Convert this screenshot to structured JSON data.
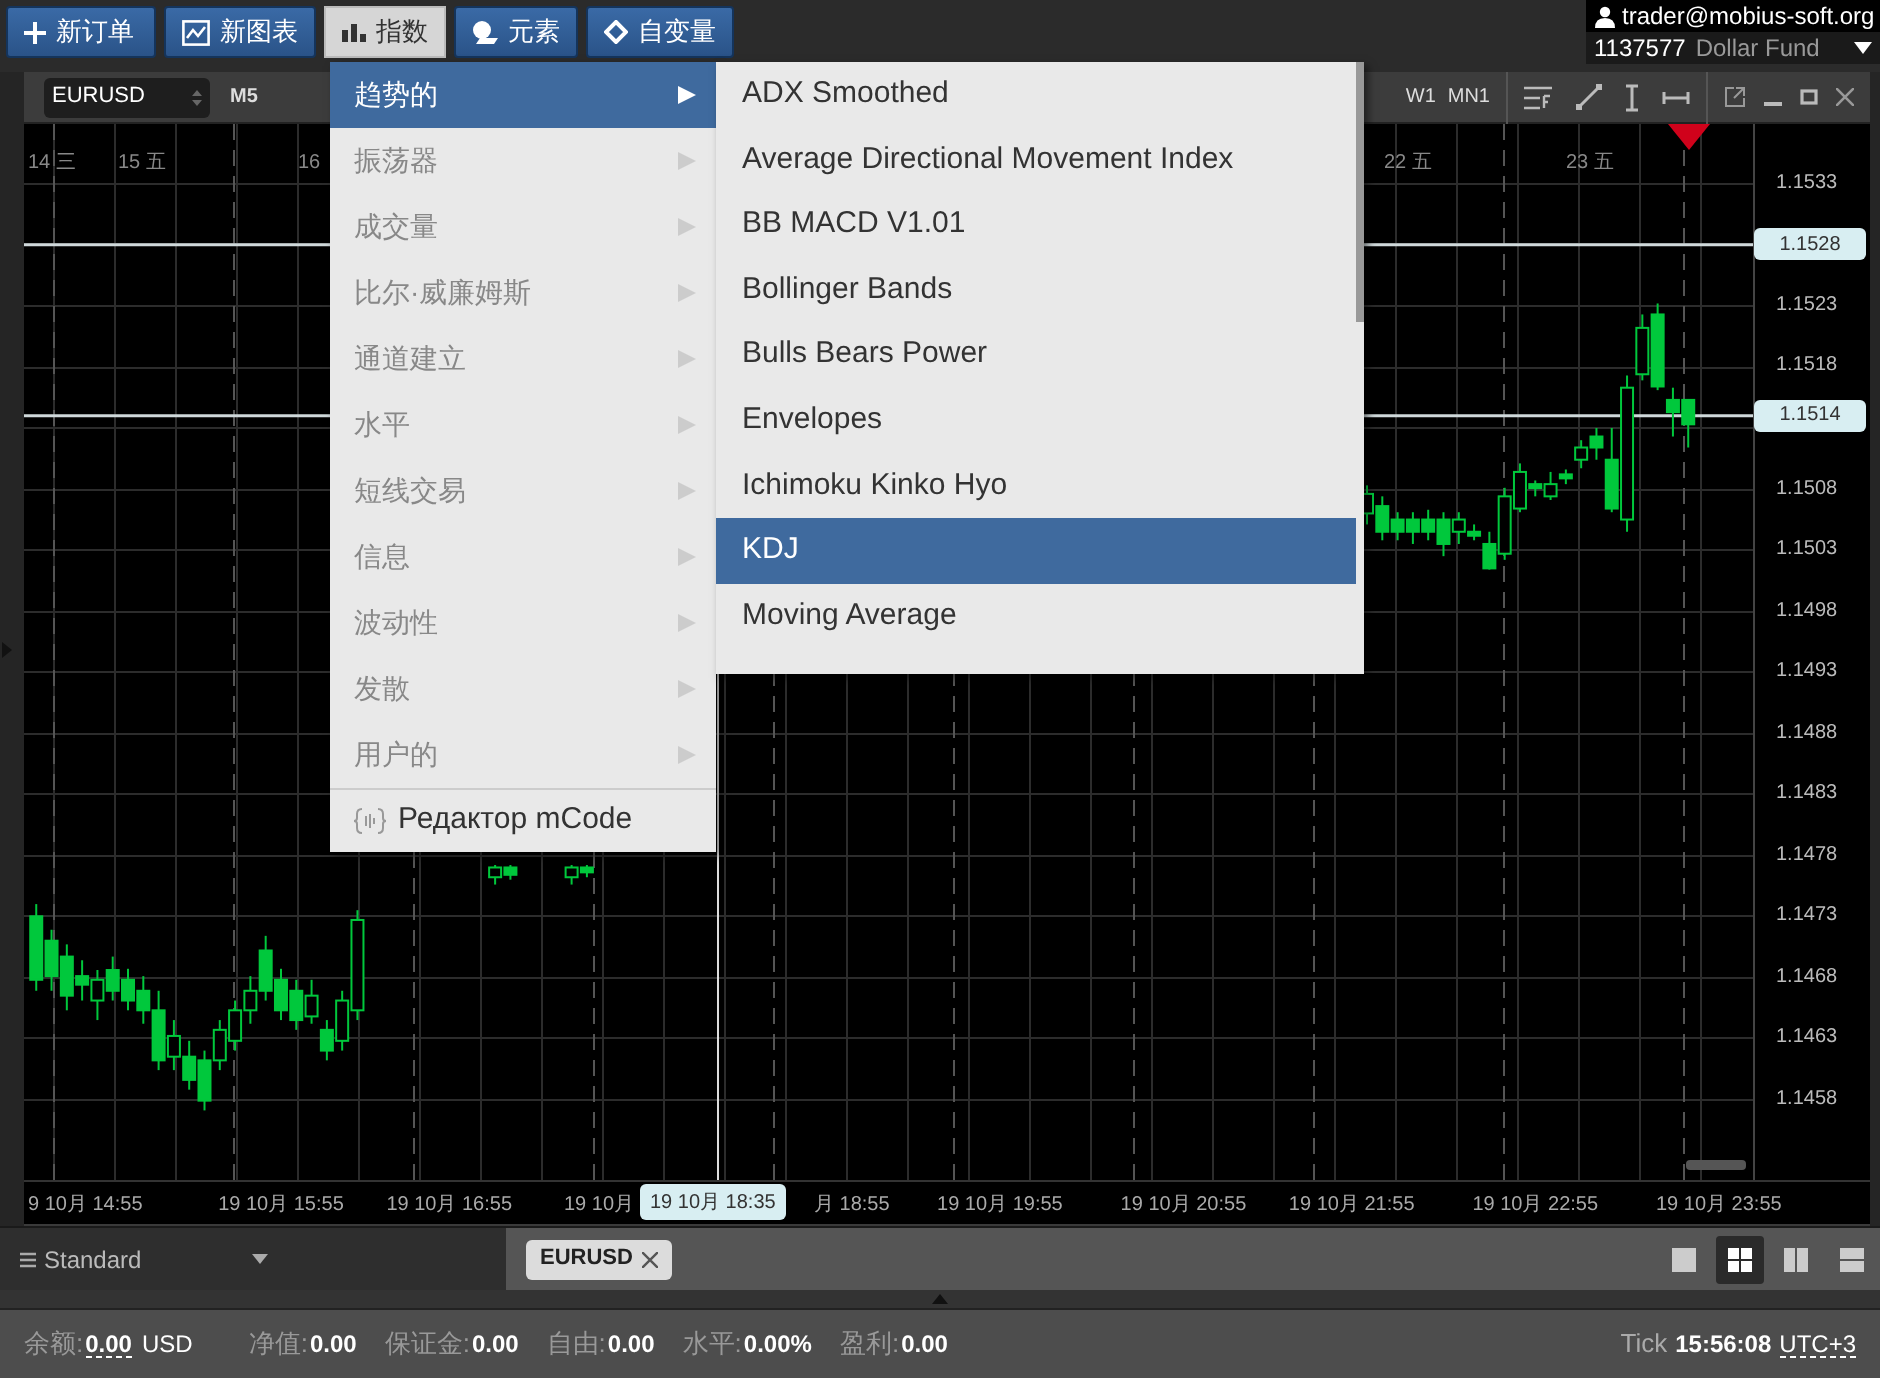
{
  "toolbar": {
    "buttons": [
      {
        "kind": "plus",
        "label": "新订单",
        "selected": false
      },
      {
        "kind": "chart",
        "label": "新图表",
        "selected": false
      },
      {
        "kind": "bars",
        "label": "指数",
        "selected": true
      },
      {
        "kind": "shapes",
        "label": "元素",
        "selected": false
      },
      {
        "kind": "diamond",
        "label": "自变量",
        "selected": false
      }
    ]
  },
  "account": {
    "user": "trader@mobius-soft.org",
    "number": "1137577",
    "fund": "Dollar Fund"
  },
  "chart_window": {
    "symbol": "EURUSD",
    "timeframe": "M5",
    "periods": [
      "W1",
      "MN1"
    ]
  },
  "chart": {
    "day_labels": [
      "14 三",
      "15 五",
      "16",
      "22 五",
      "23 五"
    ],
    "chart_data": {
      "type": "candlestick",
      "grid": true,
      "ylim": [
        1.14514,
        1.15379
      ],
      "ref_lines": [
        {
          "axis": "y",
          "value": 1.1528,
          "label": "1.1528"
        },
        {
          "axis": "y",
          "value": 1.1514,
          "label": "1.1514"
        }
      ],
      "categories": [
        null,
        null,
        null,
        null,
        null,
        null,
        null,
        null,
        null,
        null,
        null,
        null,
        null,
        null,
        null,
        null,
        "19 10月 15:55",
        null,
        null,
        null,
        null,
        null,
        null,
        null,
        null,
        null,
        null,
        "19 10月 16:55",
        null,
        null,
        null,
        null,
        null,
        null,
        null,
        null,
        null,
        null,
        null,
        null,
        null,
        null,
        null,
        null,
        null,
        null,
        null,
        null,
        null,
        null,
        null,
        null,
        null,
        null,
        null,
        null,
        null,
        null,
        null,
        null,
        null,
        null,
        null,
        "19 10月 19:55",
        null,
        null,
        null,
        null,
        null,
        null,
        null,
        null,
        null,
        null,
        null,
        "19 10月 20:55",
        null,
        null,
        null,
        null,
        null,
        null,
        null,
        null,
        null,
        null,
        "19 10月 21:55",
        null,
        null,
        null,
        null,
        null,
        null,
        null,
        null,
        null,
        null,
        null,
        "19 10月 22:55",
        null,
        null,
        null,
        null,
        null,
        null,
        null,
        null,
        null,
        null,
        null,
        "19 10月 23:55"
      ],
      "yticks": [
        {
          "value": 1.1533,
          "label": "1.1533"
        },
        {
          "value": 1.1523,
          "label": "1.1523"
        },
        {
          "value": 1.1518,
          "label": "1.1518"
        },
        {
          "value": 1.1508,
          "label": "1.1508"
        },
        {
          "value": 1.1503,
          "label": "1.1503"
        },
        {
          "value": 1.1498,
          "label": "1.1498"
        },
        {
          "value": 1.1493,
          "label": "1.1493"
        },
        {
          "value": 1.1488,
          "label": "1.1488"
        },
        {
          "value": 1.1483,
          "label": "1.1483"
        },
        {
          "value": 1.1478,
          "label": "1.1478"
        },
        {
          "value": 1.1473,
          "label": "1.1473"
        },
        {
          "value": 1.1468,
          "label": "1.1468"
        },
        {
          "value": 1.1463,
          "label": "1.1463"
        },
        {
          "value": 1.1458,
          "label": "1.1458"
        }
      ],
      "ohlc": [
        [
          1.1473,
          1.1474,
          1.14669,
          1.14678
        ],
        [
          1.1471,
          1.14719,
          1.14669,
          1.14681
        ],
        [
          1.14697,
          1.14707,
          1.14653,
          1.14665
        ],
        [
          1.14681,
          1.14694,
          1.14661,
          1.14674
        ],
        [
          1.14661,
          1.14686,
          1.14645,
          1.14678
        ],
        [
          1.14686,
          1.14697,
          1.14661,
          1.14669
        ],
        [
          1.14678,
          1.14687,
          1.14653,
          1.14661
        ],
        [
          1.14669,
          1.14681,
          1.14642,
          1.14653
        ],
        [
          1.14653,
          1.14669,
          1.14604,
          1.14612
        ],
        [
          1.14615,
          1.14645,
          1.14604,
          1.14632
        ],
        [
          1.14615,
          1.14628,
          1.14588,
          1.14596
        ],
        [
          1.14612,
          1.1462,
          1.14571,
          1.14579
        ],
        [
          1.14612,
          1.14645,
          1.14604,
          1.14637
        ],
        [
          1.14628,
          1.14661,
          1.1462,
          1.14653
        ],
        [
          1.14653,
          1.14681,
          1.14642,
          1.14669
        ],
        [
          1.14702,
          1.14714,
          1.14661,
          1.14669
        ],
        [
          1.14678,
          1.14687,
          1.14645,
          1.14653
        ],
        [
          1.14669,
          1.14678,
          1.14637,
          1.14645
        ],
        [
          1.14648,
          1.14678,
          1.14642,
          1.14665
        ],
        [
          1.14637,
          1.14645,
          1.14612,
          1.1462
        ],
        [
          1.14628,
          1.14669,
          1.1462,
          1.14661
        ],
        [
          1.14653,
          1.14735,
          1.14645,
          1.14727
        ],
        null,
        null,
        null,
        null,
        null,
        null,
        null,
        null,
        [
          1.14762,
          1.14772,
          1.14756,
          1.1477
        ],
        [
          1.1477,
          1.14772,
          1.1476,
          1.14764
        ],
        null,
        null,
        null,
        [
          1.14762,
          1.14772,
          1.14756,
          1.1477
        ],
        [
          1.1477,
          1.14772,
          1.14762,
          1.14766
        ],
        null,
        null,
        null,
        null,
        null,
        null,
        null,
        null,
        null,
        null,
        null,
        null,
        null,
        null,
        null,
        null,
        null,
        null,
        null,
        null,
        null,
        null,
        null,
        null,
        null,
        null,
        null,
        null,
        null,
        null,
        null,
        null,
        null,
        null,
        null,
        null,
        null,
        null,
        null,
        null,
        null,
        null,
        null,
        null,
        null,
        null,
        null,
        null,
        null,
        null,
        [
          1.1506,
          1.15083,
          1.15051,
          1.15076
        ],
        [
          1.15066,
          1.15074,
          1.15038,
          1.15045
        ],
        [
          1.15055,
          1.15061,
          1.15038,
          1.15045
        ],
        [
          1.15055,
          1.15061,
          1.15035,
          1.15045
        ],
        [
          1.15055,
          1.15063,
          1.15038,
          1.15045
        ],
        [
          1.15055,
          1.15061,
          1.15025,
          1.15035
        ],
        [
          1.15045,
          1.15061,
          1.15035,
          1.15055
        ],
        [
          1.15045,
          1.15051,
          1.15038,
          1.15042
        ],
        [
          1.15035,
          1.15045,
          1.15014,
          1.15015
        ],
        [
          1.15027,
          1.15081,
          1.15022,
          1.15074
        ],
        [
          1.15064,
          1.15101,
          1.15061,
          1.15094
        ],
        [
          1.15084,
          1.15087,
          1.15074,
          1.15081
        ],
        [
          1.15074,
          1.15094,
          1.15071,
          1.15084
        ],
        [
          1.15092,
          1.15096,
          1.15084,
          1.15089
        ],
        [
          1.15104,
          1.1512,
          1.15097,
          1.15114
        ],
        [
          1.15123,
          1.1513,
          1.15104,
          1.15114
        ],
        [
          1.15104,
          1.1513,
          1.15061,
          1.15064
        ],
        [
          1.15055,
          1.15173,
          1.15045,
          1.15163
        ],
        [
          1.15174,
          1.15223,
          1.15169,
          1.15212
        ],
        [
          1.15223,
          1.15232,
          1.15161,
          1.15164
        ],
        [
          1.15153,
          1.15163,
          1.15123,
          1.15143
        ],
        [
          1.15153,
          1.15153,
          1.15114,
          1.15133
        ],
        null,
        null
      ]
    },
    "time_labels": [
      "9 10月 14:55",
      "19 10月",
      "月 18:55"
    ],
    "crosshair_time": "19 10月 18:35"
  },
  "menu": {
    "items": [
      {
        "label": "趋势的",
        "selected": true
      },
      {
        "label": "振荡器",
        "selected": false
      },
      {
        "label": "成交量",
        "selected": false
      },
      {
        "label": "比尔·威廉姆斯",
        "selected": false
      },
      {
        "label": "通道建立",
        "selected": false
      },
      {
        "label": "水平",
        "selected": false
      },
      {
        "label": "短线交易",
        "selected": false
      },
      {
        "label": "信息",
        "selected": false
      },
      {
        "label": "波动性",
        "selected": false
      },
      {
        "label": "发散",
        "selected": false
      },
      {
        "label": "用户的",
        "selected": false
      }
    ],
    "footer": "Редактор mCode"
  },
  "submenu": {
    "items": [
      {
        "label": "ADX Smoothed",
        "selected": false
      },
      {
        "label": "Average Directional Movement Index",
        "selected": false
      },
      {
        "label": "BB MACD V1.01",
        "selected": false
      },
      {
        "label": "Bollinger Bands",
        "selected": false
      },
      {
        "label": "Bulls Bears Power",
        "selected": false
      },
      {
        "label": "Envelopes",
        "selected": false
      },
      {
        "label": "Ichimoku Kinko Hyo",
        "selected": false
      },
      {
        "label": "KDJ",
        "selected": true
      },
      {
        "label": "Moving Average",
        "selected": false
      }
    ]
  },
  "bottom": {
    "layout": "Standard",
    "tabs": [
      {
        "label": "EURUSD"
      }
    ],
    "layouts": [
      {
        "kind": "single",
        "selected": false
      },
      {
        "kind": "grid",
        "selected": true
      },
      {
        "kind": "columns",
        "selected": false
      },
      {
        "kind": "rows",
        "selected": false
      }
    ]
  },
  "status": {
    "fields": [
      {
        "label": "余额:",
        "value": "0.00",
        "unit": "USD"
      },
      {
        "label": "净值:",
        "value": "0.00"
      },
      {
        "label": "保证金:",
        "value": "0.00"
      },
      {
        "label": "自由:",
        "value": "0.00"
      },
      {
        "label": "水平:",
        "value": "0.00%"
      },
      {
        "label": "盈利:",
        "value": "0.00"
      }
    ],
    "tick_label": "Tick",
    "time": "15:56:08",
    "timezone": "UTC+3"
  }
}
